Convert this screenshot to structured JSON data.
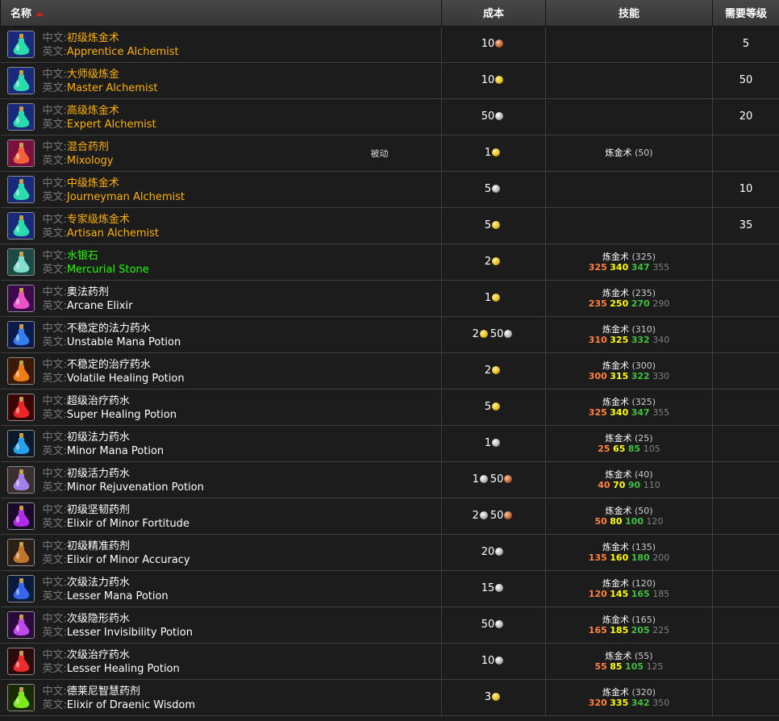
{
  "header": {
    "name": "名称",
    "cost": "成本",
    "skill": "技能",
    "level": "需要等级"
  },
  "labels": {
    "cn": "中文:",
    "en": "英文:"
  },
  "rows": [
    {
      "icon": "icon-green-potion",
      "cn": "初级炼金术",
      "en": "Apprentice Alchemist",
      "color": "orange",
      "cost": [
        {
          "n": "10",
          "t": "copper"
        }
      ],
      "level": "5"
    },
    {
      "icon": "icon-green-potion",
      "cn": "大师级炼金",
      "en": "Master Alchemist",
      "color": "orange",
      "cost": [
        {
          "n": "10",
          "t": "gold"
        }
      ],
      "level": "50"
    },
    {
      "icon": "icon-green-potion",
      "cn": "高级炼金术",
      "en": "Expert Alchemist",
      "color": "orange",
      "cost": [
        {
          "n": "50",
          "t": "silver"
        }
      ],
      "level": "20"
    },
    {
      "icon": "icon-mixology",
      "cn": "混合药剂",
      "en": "Mixology",
      "color": "orange",
      "passive": "被动",
      "cost": [
        {
          "n": "1",
          "t": "gold"
        }
      ],
      "skill": {
        "name": "炼金术",
        "req": "50"
      }
    },
    {
      "icon": "icon-green-potion",
      "cn": "中级炼金术",
      "en": "Journeyman Alchemist",
      "color": "orange",
      "cost": [
        {
          "n": "5",
          "t": "silver"
        }
      ],
      "level": "10"
    },
    {
      "icon": "icon-green-potion",
      "cn": "专家级炼金术",
      "en": "Artisan Alchemist",
      "color": "orange",
      "cost": [
        {
          "n": "5",
          "t": "gold"
        }
      ],
      "level": "35"
    },
    {
      "icon": "icon-mercurial-stone",
      "cn": "水银石",
      "en": "Mercurial Stone",
      "color": "green",
      "cost": [
        {
          "n": "2",
          "t": "gold"
        }
      ],
      "skill": {
        "name": "炼金术",
        "req": "325",
        "levels": [
          "325",
          "340",
          "347",
          "355"
        ]
      }
    },
    {
      "icon": "icon-pink-flask",
      "cn": "奥法药剂",
      "en": "Arcane Elixir",
      "color": "white",
      "cost": [
        {
          "n": "1",
          "t": "gold"
        }
      ],
      "skill": {
        "name": "炼金术",
        "req": "235",
        "levels": [
          "235",
          "250",
          "270",
          "290"
        ]
      }
    },
    {
      "icon": "icon-blue-potion",
      "cn": "不稳定的法力药水",
      "en": "Unstable Mana Potion",
      "color": "white",
      "cost": [
        {
          "n": "2",
          "t": "gold"
        },
        {
          "n": "50",
          "t": "silver"
        }
      ],
      "skill": {
        "name": "炼金术",
        "req": "310",
        "levels": [
          "310",
          "325",
          "332",
          "340"
        ]
      }
    },
    {
      "icon": "icon-orange-potion",
      "cn": "不稳定的治疗药水",
      "en": "Volatile Healing Potion",
      "color": "white",
      "cost": [
        {
          "n": "2",
          "t": "gold"
        }
      ],
      "skill": {
        "name": "炼金术",
        "req": "300",
        "levels": [
          "300",
          "315",
          "322",
          "330"
        ]
      }
    },
    {
      "icon": "icon-red-potion",
      "cn": "超级治疗药水",
      "en": "Super Healing Potion",
      "color": "white",
      "cost": [
        {
          "n": "5",
          "t": "gold"
        }
      ],
      "skill": {
        "name": "炼金术",
        "req": "325",
        "levels": [
          "325",
          "340",
          "347",
          "355"
        ]
      }
    },
    {
      "icon": "icon-cyan-vial",
      "cn": "初级法力药水",
      "en": "Minor Mana Potion",
      "color": "white",
      "cost": [
        {
          "n": "1",
          "t": "silver"
        }
      ],
      "skill": {
        "name": "炼金术",
        "req": "25",
        "levels": [
          "25",
          "65",
          "85",
          "105"
        ]
      }
    },
    {
      "icon": "icon-purple-jar",
      "cn": "初级活力药水",
      "en": "Minor Rejuvenation Potion",
      "color": "white",
      "cost": [
        {
          "n": "1",
          "t": "silver"
        },
        {
          "n": "50",
          "t": "copper"
        }
      ],
      "skill": {
        "name": "炼金术",
        "req": "40",
        "levels": [
          "40",
          "70",
          "90",
          "110"
        ]
      }
    },
    {
      "icon": "icon-purple-vial",
      "cn": "初级坚韧药剂",
      "en": "Elixir of Minor Fortitude",
      "color": "white",
      "cost": [
        {
          "n": "2",
          "t": "silver"
        },
        {
          "n": "50",
          "t": "copper"
        }
      ],
      "skill": {
        "name": "炼金术",
        "req": "50",
        "levels": [
          "50",
          "80",
          "100",
          "120"
        ]
      }
    },
    {
      "icon": "icon-dark-flask",
      "cn": "初级精准药剂",
      "en": "Elixir of Minor Accuracy",
      "color": "white",
      "cost": [
        {
          "n": "20",
          "t": "silver"
        }
      ],
      "skill": {
        "name": "炼金术",
        "req": "135",
        "levels": [
          "135",
          "160",
          "180",
          "200"
        ]
      }
    },
    {
      "icon": "icon-blue-tube",
      "cn": "次级法力药水",
      "en": "Lesser Mana Potion",
      "color": "white",
      "cost": [
        {
          "n": "15",
          "t": "silver"
        }
      ],
      "skill": {
        "name": "炼金术",
        "req": "120",
        "levels": [
          "120",
          "145",
          "165",
          "185"
        ]
      }
    },
    {
      "icon": "icon-violet-tube",
      "cn": "次级隐形药水",
      "en": "Lesser Invisibility Potion",
      "color": "white",
      "cost": [
        {
          "n": "50",
          "t": "silver"
        }
      ],
      "skill": {
        "name": "炼金术",
        "req": "165",
        "levels": [
          "165",
          "185",
          "205",
          "225"
        ]
      }
    },
    {
      "icon": "icon-red-tube",
      "cn": "次级治疗药水",
      "en": "Lesser Healing Potion",
      "color": "white",
      "cost": [
        {
          "n": "10",
          "t": "silver"
        }
      ],
      "skill": {
        "name": "炼金术",
        "req": "55",
        "levels": [
          "55",
          "85",
          "105",
          "125"
        ]
      }
    },
    {
      "icon": "icon-lime-potion",
      "cn": "德莱尼智慧药剂",
      "en": "Elixir of Draenic Wisdom",
      "color": "white",
      "cost": [
        {
          "n": "3",
          "t": "gold"
        }
      ],
      "skill": {
        "name": "炼金术",
        "req": "320",
        "levels": [
          "320",
          "335",
          "342",
          "350"
        ]
      }
    }
  ],
  "icon_colors": {
    "icon-green-potion": [
      "#1a2a7a",
      "#2cf0b0"
    ],
    "icon-mixology": [
      "#7a1040",
      "#ff6a3a"
    ],
    "icon-mercurial-stone": [
      "#1d4a44",
      "#8ff0e0"
    ],
    "icon-pink-flask": [
      "#3a0a4a",
      "#ff5ad0"
    ],
    "icon-blue-potion": [
      "#0a1a4a",
      "#3a8aff"
    ],
    "icon-orange-potion": [
      "#3a1a05",
      "#ff8a1a"
    ],
    "icon-red-potion": [
      "#3a0505",
      "#ff2a2a"
    ],
    "icon-cyan-vial": [
      "#0a1a2a",
      "#2ab0ff"
    ],
    "icon-purple-jar": [
      "#3a3030",
      "#b08aff"
    ],
    "icon-purple-vial": [
      "#1a0a2a",
      "#c030ff"
    ],
    "icon-dark-flask": [
      "#2a2018",
      "#d08030"
    ],
    "icon-blue-tube": [
      "#0a1a3a",
      "#3a70ff"
    ],
    "icon-violet-tube": [
      "#2a0a3a",
      "#d050ff"
    ],
    "icon-red-tube": [
      "#2a0a0a",
      "#ff3030"
    ],
    "icon-lime-potion": [
      "#1a2a05",
      "#8aff20"
    ]
  }
}
